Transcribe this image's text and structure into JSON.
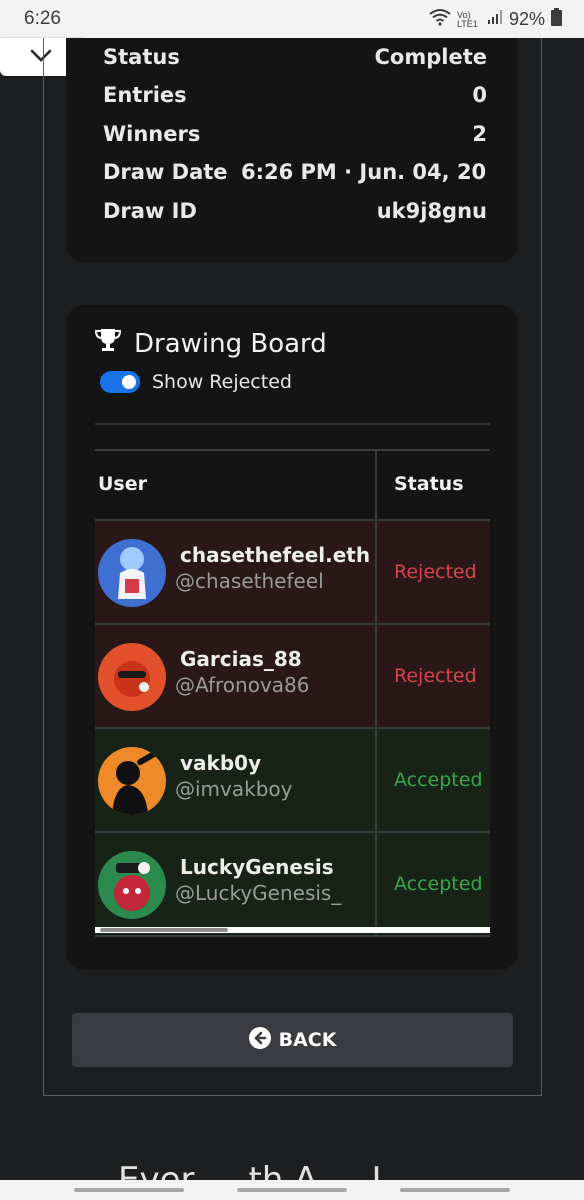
{
  "status_bar": {
    "time": "6:26",
    "network": "Vo) LTE1",
    "battery": "92%"
  },
  "info": {
    "rows": [
      {
        "label": "Status",
        "value": "Complete"
      },
      {
        "label": "Entries",
        "value": "0"
      },
      {
        "label": "Winners",
        "value": "2"
      },
      {
        "label": "Draw Date",
        "value": "6:26 PM · Jun. 04, 20"
      },
      {
        "label": "Draw ID",
        "value": "uk9j8gnu"
      }
    ]
  },
  "board": {
    "title": "Drawing Board",
    "toggle_label": "Show Rejected",
    "toggle_on": true,
    "columns": [
      "User",
      "Status"
    ],
    "rows": [
      {
        "name": "chasethefeel.eth",
        "handle": "@chasethefeel",
        "status": "Rejected",
        "kind": "rejected",
        "avatar_color": "#4a7fd6"
      },
      {
        "name": "Garcias_88",
        "handle": "@Afronova86",
        "status": "Rejected",
        "kind": "rejected",
        "avatar_color": "#e2512c"
      },
      {
        "name": "vakb0y",
        "handle": "@imvakboy",
        "status": "Accepted",
        "kind": "accepted",
        "avatar_color": "#ef8a2a"
      },
      {
        "name": "LuckyGenesis",
        "handle": "@LuckyGenesis_",
        "status": "Accepted",
        "kind": "accepted",
        "avatar_color": "#2d8a4e"
      }
    ]
  },
  "back_label": "BACK",
  "footer_partial": "Ever ... th A ... I"
}
